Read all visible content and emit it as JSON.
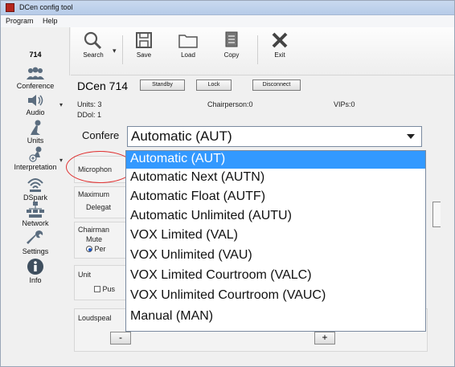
{
  "window": {
    "title": "DCen config tool"
  },
  "menu": [
    "Program",
    "Help"
  ],
  "device_label": "714",
  "toolbar": {
    "search": "Search",
    "save": "Save",
    "load": "Load",
    "copy": "Copy",
    "exit": "Exit"
  },
  "sidebar": [
    {
      "label": "Conference",
      "icon": "conference-icon"
    },
    {
      "label": "Audio",
      "icon": "speaker-icon"
    },
    {
      "label": "Units",
      "icon": "microphone-icon"
    },
    {
      "label": "Interpretation",
      "icon": "interpretation-icon"
    },
    {
      "label": "DSpark",
      "icon": "dspark-icon"
    },
    {
      "label": "Network",
      "icon": "network-icon"
    },
    {
      "label": "Settings",
      "icon": "wrench-icon"
    },
    {
      "label": "Info",
      "icon": "info-icon"
    }
  ],
  "header": {
    "device_name": "DCen 714",
    "standby": "Standby",
    "lock": "Lock",
    "disconnect": "Disconnect",
    "units": "Units: 3",
    "ddol": "DDol: 1",
    "chairperson": "Chairperson:0",
    "vips": "VIPs:0"
  },
  "conference": {
    "label": "Confere",
    "selected": "Automatic (AUT)",
    "options": [
      "Automatic (AUT)",
      "Automatic Next (AUTN)",
      "Automatic Float (AUTF)",
      "Automatic Unlimited (AUTU)",
      "VOX Limited (VAL)",
      "VOX Unlimited (VAU)",
      "VOX Limited Courtroom (VALC)",
      "VOX Unlimited Courtroom (VAUC)",
      "Manual (MAN)"
    ]
  },
  "groups": {
    "microphone": "Microphon",
    "maximum": "Maximum",
    "delegate": "Delegat",
    "chairman": "Chairman",
    "mute": "Mute",
    "per": "Per",
    "unit": "Unit",
    "push": "Pus",
    "loudspeaker": "Loudspeal",
    "minus": "-",
    "plus": "+"
  },
  "colors": {
    "selection": "#3399ff",
    "annotation": "#e03030"
  }
}
